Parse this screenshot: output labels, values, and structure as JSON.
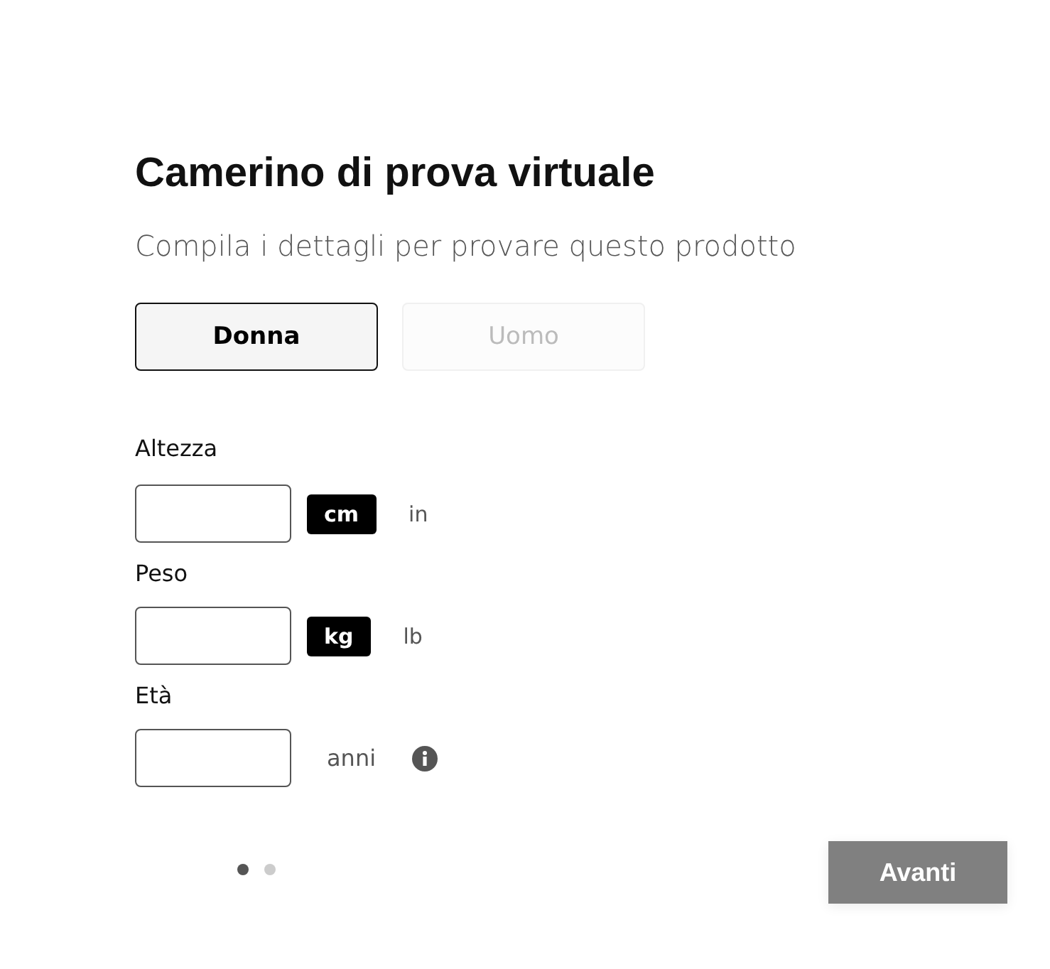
{
  "title": "Camerino di prova virtuale",
  "subtitle": "Compila i dettagli per provare questo prodotto",
  "tabs": [
    {
      "label": "Donna",
      "selected": true
    },
    {
      "label": "Uomo",
      "selected": false
    }
  ],
  "fields": [
    {
      "kind": "units",
      "label": "Altezza",
      "units": [
        {
          "label": "cm",
          "selected": true
        },
        {
          "label": "in",
          "selected": false
        }
      ]
    },
    {
      "kind": "units",
      "label": "Peso",
      "units": [
        {
          "label": "kg",
          "selected": true
        },
        {
          "label": "lb",
          "selected": false
        }
      ]
    },
    {
      "kind": "age",
      "label": "Età",
      "suffix": "anni"
    }
  ],
  "steps": [
    {
      "selected": true
    },
    {
      "selected": false
    }
  ],
  "next_button": {
    "label": "Avanti",
    "disabled": true
  }
}
